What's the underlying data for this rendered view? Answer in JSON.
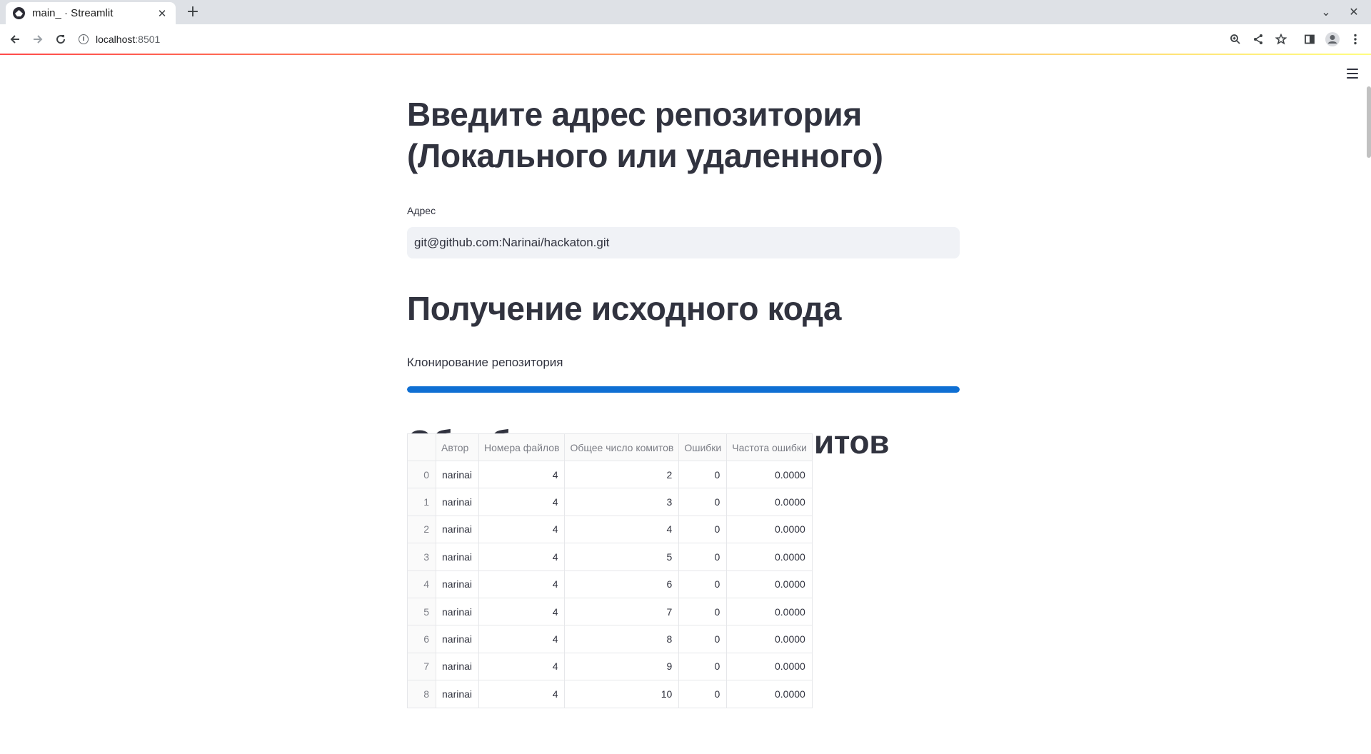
{
  "browser": {
    "tab_title": "main_ · Streamlit",
    "url_host": "localhost",
    "url_port": ":8501"
  },
  "app": {
    "repo_heading": "Введите адрес репозитория (Локального или удаленного)",
    "address_label": "Адрес",
    "address_value": "git@github.com:Narinai/hackaton.git",
    "source_heading": "Получение исходного кода",
    "progress_text": "Клонирование репозитория",
    "progress_percent": 100,
    "commits_heading": "Обработка истории коммитов",
    "colors": {
      "progress": "#0f6fd3",
      "text": "#31333f",
      "accent_gradient_start": "#ff4b4b",
      "accent_gradient_end": "#fffd80"
    }
  },
  "table": {
    "columns": [
      "Автор",
      "Номера файлов",
      "Общее число комитов",
      "Ошибки",
      "Частота ошибки"
    ],
    "rows": [
      {
        "index": "0",
        "author": "narinai",
        "files": "4",
        "commits": "2",
        "errors": "0",
        "rate": "0.0000"
      },
      {
        "index": "1",
        "author": "narinai",
        "files": "4",
        "commits": "3",
        "errors": "0",
        "rate": "0.0000"
      },
      {
        "index": "2",
        "author": "narinai",
        "files": "4",
        "commits": "4",
        "errors": "0",
        "rate": "0.0000"
      },
      {
        "index": "3",
        "author": "narinai",
        "files": "4",
        "commits": "5",
        "errors": "0",
        "rate": "0.0000"
      },
      {
        "index": "4",
        "author": "narinai",
        "files": "4",
        "commits": "6",
        "errors": "0",
        "rate": "0.0000"
      },
      {
        "index": "5",
        "author": "narinai",
        "files": "4",
        "commits": "7",
        "errors": "0",
        "rate": "0.0000"
      },
      {
        "index": "6",
        "author": "narinai",
        "files": "4",
        "commits": "8",
        "errors": "0",
        "rate": "0.0000"
      },
      {
        "index": "7",
        "author": "narinai",
        "files": "4",
        "commits": "9",
        "errors": "0",
        "rate": "0.0000"
      },
      {
        "index": "8",
        "author": "narinai",
        "files": "4",
        "commits": "10",
        "errors": "0",
        "rate": "0.0000"
      }
    ]
  },
  "icons": {
    "favicon": "streamlit-icon",
    "close": "close-icon",
    "new_tab": "plus-icon",
    "back": "arrow-left-icon",
    "forward": "arrow-right-icon",
    "reload": "reload-icon",
    "site_info": "info-icon",
    "zoom": "zoom-icon",
    "share": "share-icon",
    "bookmark": "star-icon",
    "side_panel": "side-panel-icon",
    "profile": "profile-icon",
    "menu": "kebab-menu-icon",
    "app_menu": "hamburger-icon"
  }
}
